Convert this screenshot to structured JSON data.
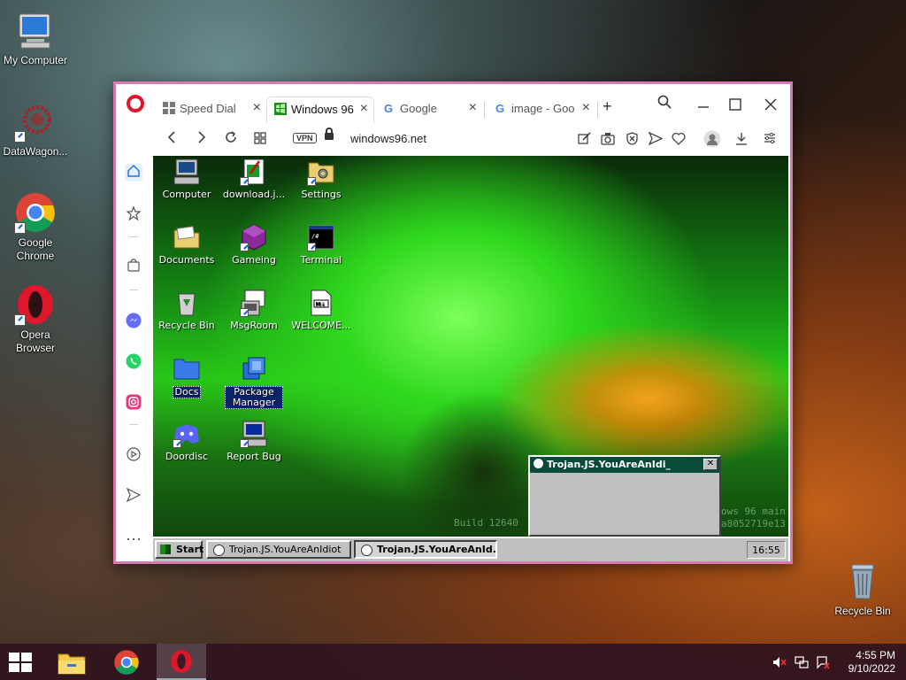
{
  "desktop": {
    "icons": [
      {
        "label": "My Computer"
      },
      {
        "label": "DataWagon..."
      },
      {
        "label": "Google Chrome"
      },
      {
        "label": "Opera Browser"
      },
      {
        "label": "Recycle Bin"
      }
    ]
  },
  "browser": {
    "tabs": [
      {
        "label": "Speed Dial",
        "active": false
      },
      {
        "label": "Windows 96",
        "active": true
      },
      {
        "label": "Google",
        "active": false
      },
      {
        "label": "image - Goo",
        "active": false
      }
    ],
    "new_tab": "+",
    "url": "windows96.net",
    "vpn_label": "VPN"
  },
  "w96": {
    "icons": [
      {
        "label": "Computer"
      },
      {
        "label": "download.j..."
      },
      {
        "label": "Settings"
      },
      {
        "label": "Documents"
      },
      {
        "label": "Gameing"
      },
      {
        "label": "Terminal"
      },
      {
        "label": "Recycle Bin"
      },
      {
        "label": "MsgRoom"
      },
      {
        "label": "WELCOME..."
      },
      {
        "label": "Docs"
      },
      {
        "label": "Package Manager"
      },
      {
        "label": "Doordisc"
      },
      {
        "label": "Report Bug"
      }
    ],
    "build_left": "Build 12640",
    "build_right_1": "ows 96 main",
    "build_right_2": "a8052719e13",
    "dialog_title": "Trojan.JS.YouAreAnIdi_",
    "taskbar": {
      "start": "Start",
      "tasks": [
        "Trojan.JS.YouAreAnIdiot",
        "Trojan.JS.YouAreAnId..."
      ],
      "clock": "16:55"
    }
  },
  "taskbar": {
    "time": "4:55 PM",
    "date": "9/10/2022"
  },
  "colors": {
    "opera_red": "#e0162b",
    "window_border": "#d67ab0",
    "w96_title": "#0a4a3a"
  }
}
